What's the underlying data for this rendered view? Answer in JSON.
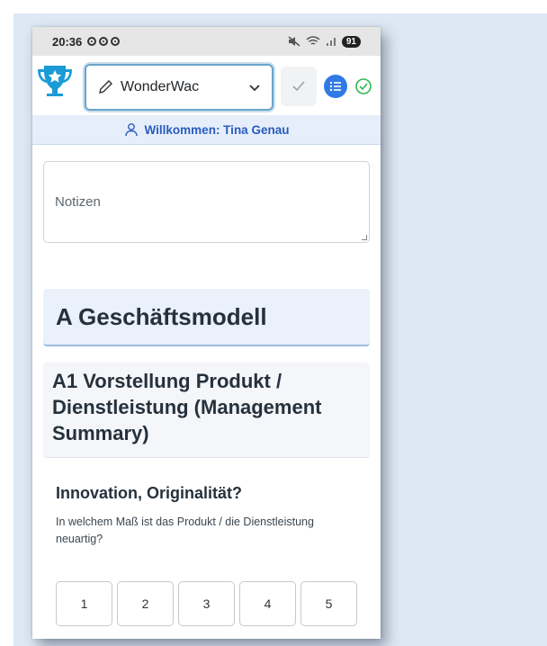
{
  "status_bar": {
    "time": "20:36",
    "battery": "91"
  },
  "header": {
    "project_name": "WonderWac"
  },
  "welcome": {
    "text": "Willkommen: Tina Genau"
  },
  "notes": {
    "placeholder": "Notizen"
  },
  "section": {
    "title": "A Geschäftsmodell"
  },
  "subsection": {
    "title": "A1 Vorstellung Produkt / Dienstleistung (Management Summary)"
  },
  "question": {
    "title": "Innovation, Originalität?",
    "description": "In welchem Maß ist das Produkt / die Dienstleistung neuartig?"
  },
  "rating": {
    "options": [
      "1",
      "2",
      "3",
      "4",
      "5"
    ]
  },
  "colors": {
    "accent": "#2f7ae5",
    "trophy": "#1a9bd6",
    "success": "#2fb84f"
  }
}
